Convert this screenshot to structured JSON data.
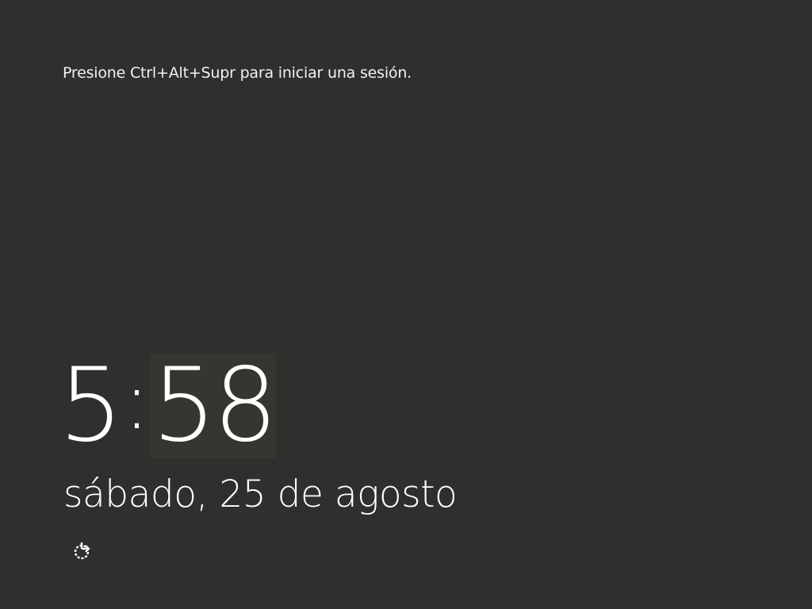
{
  "lock_screen": {
    "hint": "Presione Ctrl+Alt+Supr para iniciar una sesión.",
    "time_hours": "5",
    "time_separator": ":",
    "time_minutes": "58",
    "date": "sábado, 25 de agosto",
    "ease_of_access_icon": "ease-of-access-icon"
  },
  "colors": {
    "background": "#2f2f2e",
    "text": "#ffffff"
  }
}
